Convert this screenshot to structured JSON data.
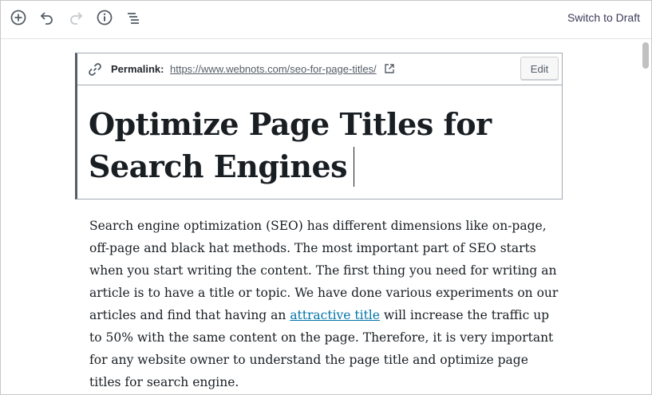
{
  "toolbar": {
    "icons": [
      "add-block-icon",
      "undo-icon",
      "redo-icon",
      "info-icon",
      "outline-icon"
    ],
    "switch_to_draft": "Switch to Draft"
  },
  "permalink": {
    "label": "Permalink:",
    "url": "https://www.webnots.com/seo-for-page-titles/",
    "edit_label": "Edit"
  },
  "post": {
    "title_line1": "Optimize Page Titles for",
    "title_line2": "Search Engines",
    "paragraph_before_link": "Search engine optimization (SEO) has different dimensions like on-page, off-page and black hat methods. The most important part of SEO starts when you start writing the content. The first thing you need for writing an article is to have a title or topic. We have done various experiments on our articles and find that having an ",
    "link_text": "attractive title",
    "paragraph_after_link": " will increase the traffic up to 50% with the same content on the page. Therefore, it is very important for any website owner to understand the page title and optimize page titles for search engine."
  },
  "colors": {
    "text": "#191e23",
    "link": "#0073aa",
    "switch_draft": "#3d3b59",
    "title_border": "#555d66"
  }
}
